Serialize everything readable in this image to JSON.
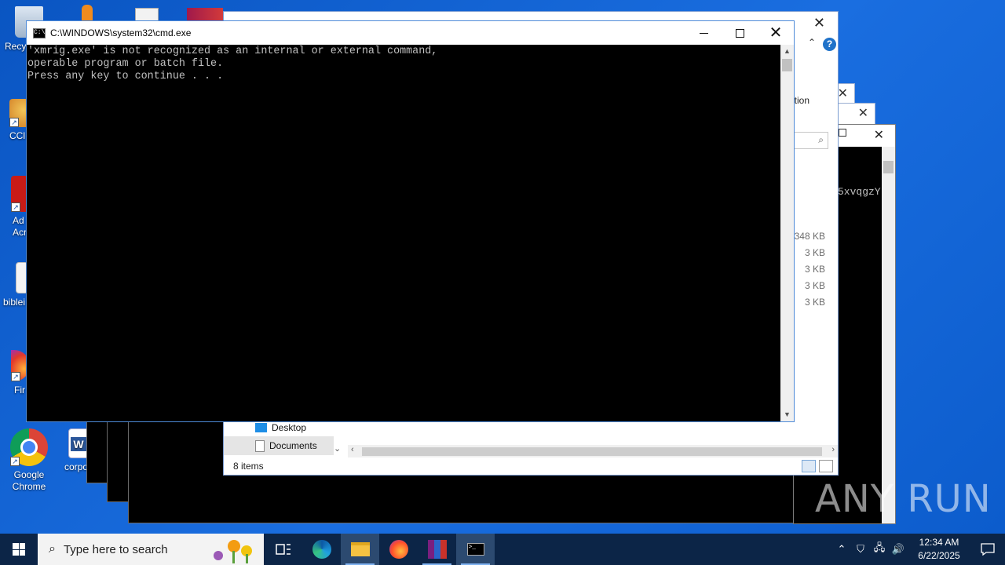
{
  "cmd": {
    "title": "C:\\WINDOWS\\system32\\cmd.exe",
    "output": "'xmrig.exe' is not recognized as an internal or external command,\noperable program or batch file.\nPress any key to continue . . .",
    "icon_text": "C:\\"
  },
  "desktop_icons": [
    {
      "label": "Recy",
      "name": "recycle-bin-icon"
    },
    {
      "label": "CCl",
      "name": "ccleaner-icon"
    },
    {
      "label": "Ad\nAcr",
      "name": "adobe-acrobat-icon"
    },
    {
      "label": "biblei",
      "name": "file-icon"
    },
    {
      "label": "Fir",
      "name": "firefox-icon"
    },
    {
      "label": "Google\nChrome",
      "name": "chrome-icon"
    },
    {
      "label": "corpo",
      "name": "word-document-icon"
    }
  ],
  "explorer": {
    "ribbon_text_1": "e",
    "ribbon_text_2": "tion",
    "sizes": [
      "348 KB",
      "3 KB",
      "3 KB",
      "3 KB",
      "3 KB"
    ],
    "nav_items": [
      "Desktop",
      "Documents"
    ],
    "status": "8 items"
  },
  "console2": {
    "text": "5xvqgzY"
  },
  "watermark": "ANY RUN",
  "taskbar": {
    "search_placeholder": "Type here to search",
    "time": "12:34 AM",
    "date": "6/22/2025"
  },
  "colors": {
    "desktop": "#0a55c2",
    "taskbar": "#0c2547",
    "console_text": "#c0c0c0"
  }
}
